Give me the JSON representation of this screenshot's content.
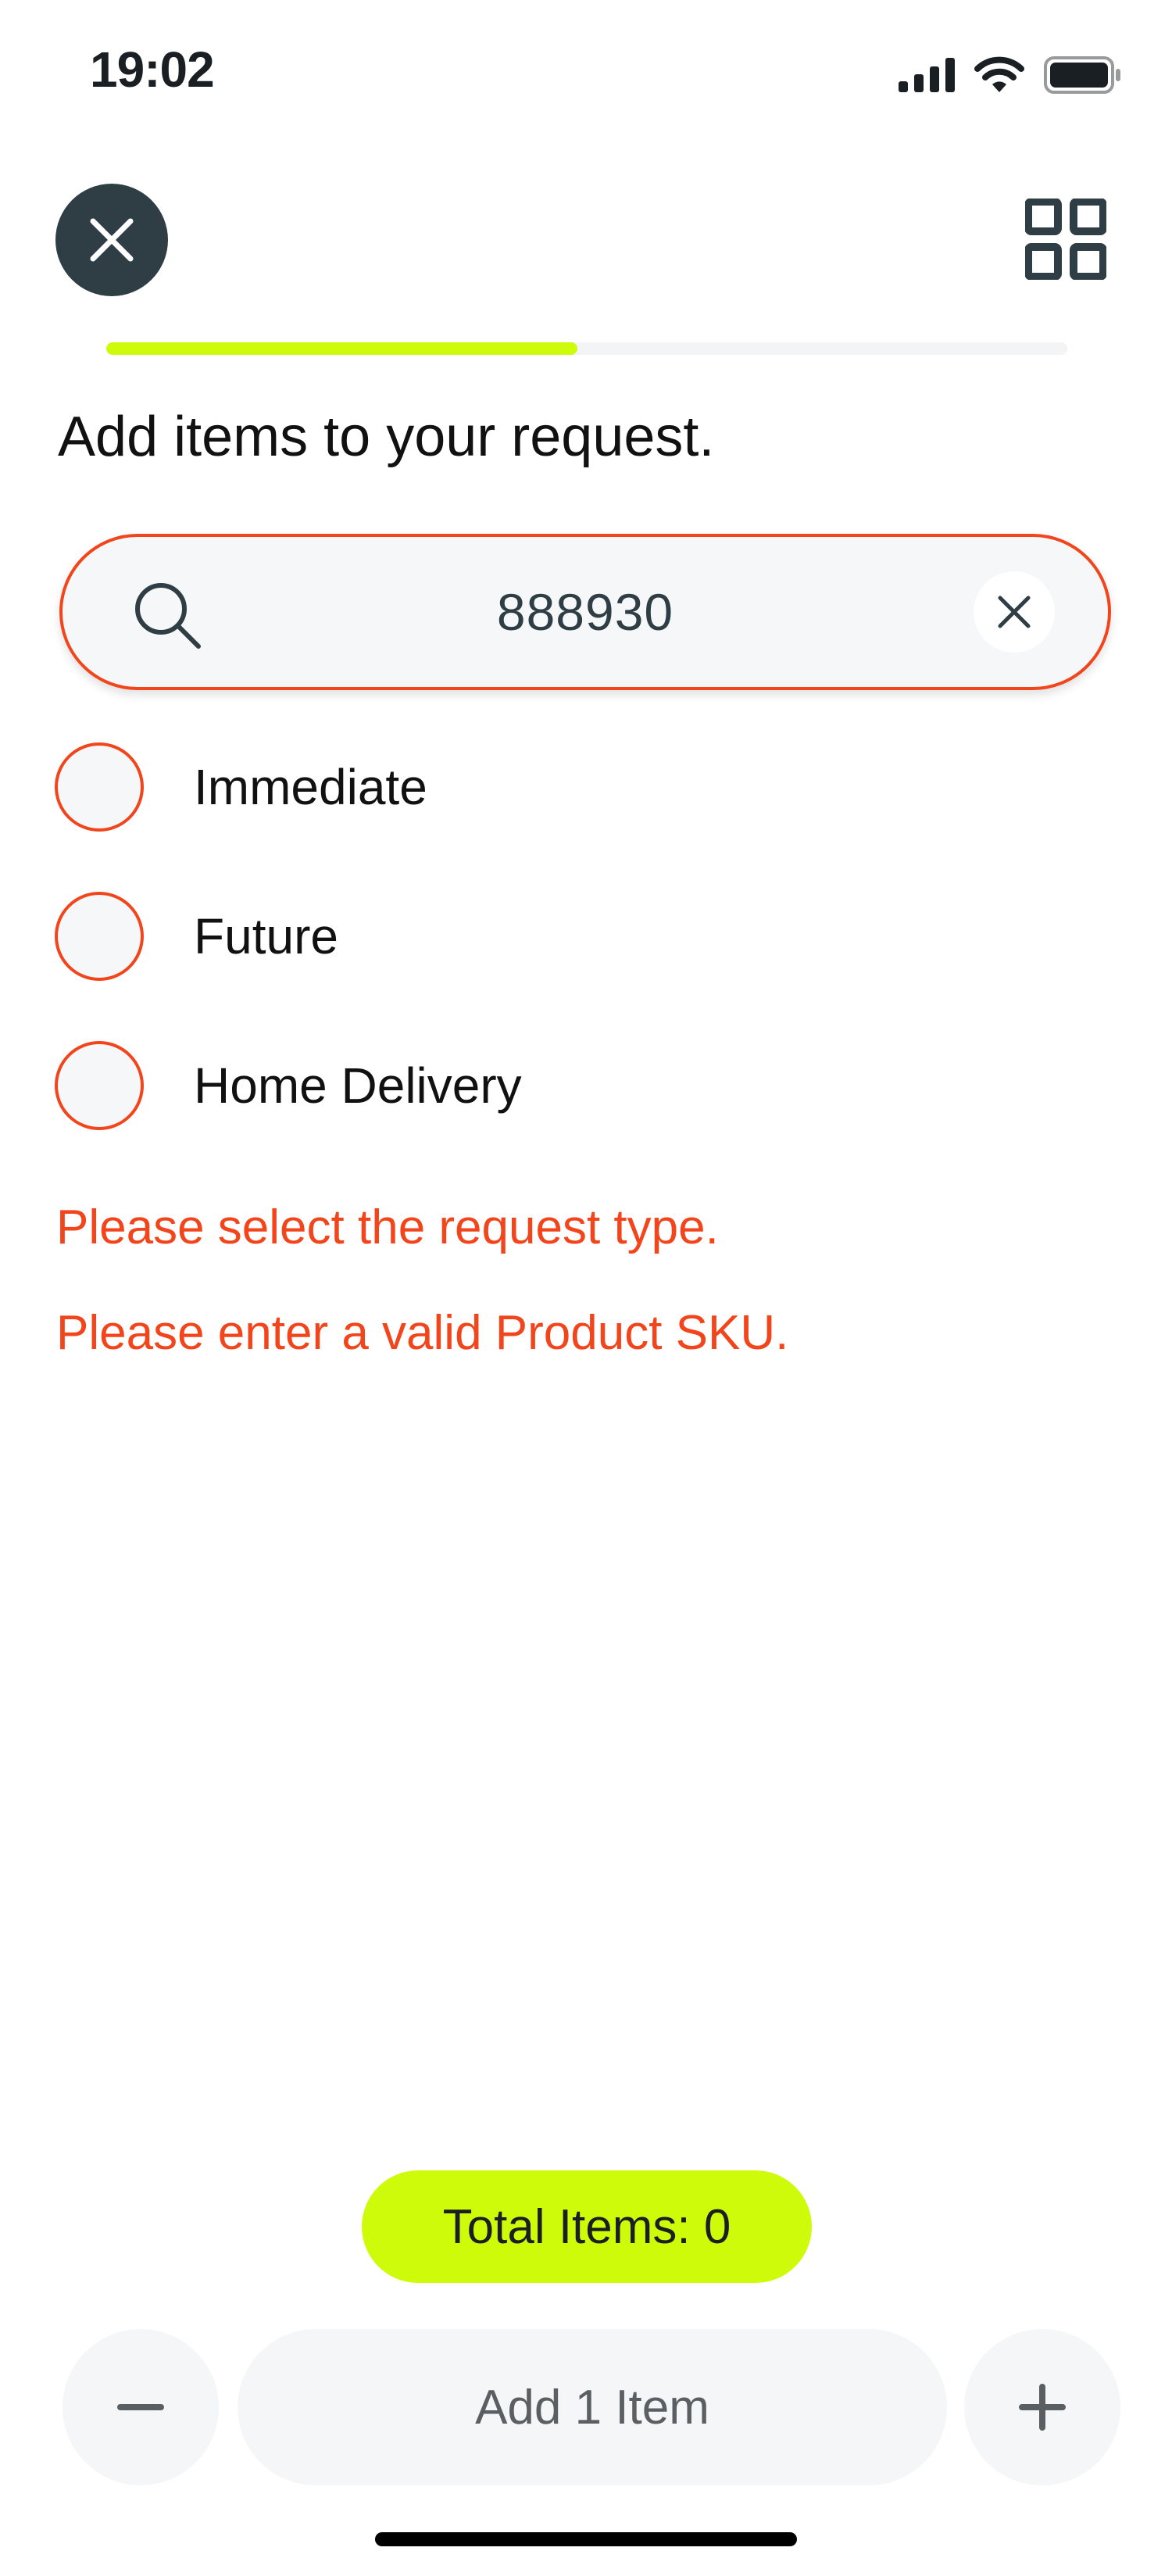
{
  "status_bar": {
    "time": "19:02",
    "icons": [
      "cellular-signal-icon",
      "wifi-icon",
      "battery-icon"
    ]
  },
  "header": {
    "close_icon": "close-icon",
    "qr_icon": "qr-grid-icon"
  },
  "progress": {
    "value": 0.49,
    "fill_color": "#CDFB0A"
  },
  "page": {
    "title": "Add items to your request."
  },
  "search": {
    "value": "888930",
    "icon": "search-icon",
    "clear_icon": "close-icon",
    "border_color": "#F2451C"
  },
  "request_types": [
    {
      "label": "Immediate"
    },
    {
      "label": "Future"
    },
    {
      "label": "Home Delivery"
    }
  ],
  "errors": {
    "request_type": "Please select the request type.",
    "sku": "Please enter a valid Product SKU."
  },
  "footer": {
    "total_items": "Total Items: 0",
    "add_label": "Add 1 Item",
    "minus_icon": "minus-icon",
    "plus_icon": "plus-icon"
  },
  "colors": {
    "accent": "#CDFB0A",
    "error": "#F2451C",
    "dark": "#2F3D45"
  }
}
